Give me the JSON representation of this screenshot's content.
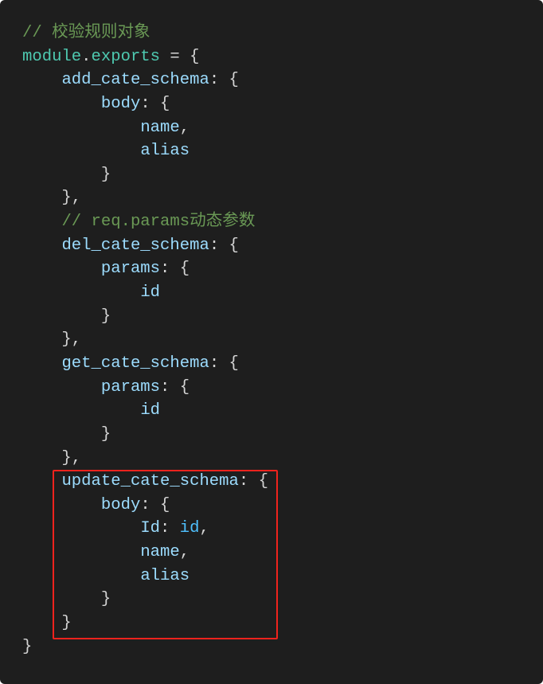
{
  "colors": {
    "background": "#1e1e1e",
    "comment": "#6a9955",
    "module": "#4ec9b0",
    "prop": "#9cdcfe",
    "punct": "#d4d4d4",
    "value": "#4fc1ff",
    "highlight": "#f0231d"
  },
  "lines": [
    [
      [
        "comment",
        "// 校验规则对象"
      ]
    ],
    [
      [
        "module",
        "module"
      ],
      [
        "punct",
        "."
      ],
      [
        "module",
        "exports"
      ],
      [
        "punct",
        " = {"
      ]
    ],
    [
      [
        "punct",
        "    "
      ],
      [
        "prop",
        "add_cate_schema"
      ],
      [
        "punct",
        ": {"
      ]
    ],
    [
      [
        "punct",
        "        "
      ],
      [
        "prop",
        "body"
      ],
      [
        "punct",
        ": {"
      ]
    ],
    [
      [
        "punct",
        "            "
      ],
      [
        "prop",
        "name"
      ],
      [
        "punct",
        ","
      ]
    ],
    [
      [
        "punct",
        "            "
      ],
      [
        "prop",
        "alias"
      ]
    ],
    [
      [
        "punct",
        "        }"
      ]
    ],
    [
      [
        "punct",
        "    },"
      ]
    ],
    [
      [
        "punct",
        "    "
      ],
      [
        "comment",
        "// req.params动态参数"
      ]
    ],
    [
      [
        "punct",
        "    "
      ],
      [
        "prop",
        "del_cate_schema"
      ],
      [
        "punct",
        ": {"
      ]
    ],
    [
      [
        "punct",
        "        "
      ],
      [
        "prop",
        "params"
      ],
      [
        "punct",
        ": {"
      ]
    ],
    [
      [
        "punct",
        "            "
      ],
      [
        "prop",
        "id"
      ]
    ],
    [
      [
        "punct",
        "        }"
      ]
    ],
    [
      [
        "punct",
        "    },"
      ]
    ],
    [
      [
        "punct",
        "    "
      ],
      [
        "prop",
        "get_cate_schema"
      ],
      [
        "punct",
        ": {"
      ]
    ],
    [
      [
        "punct",
        "        "
      ],
      [
        "prop",
        "params"
      ],
      [
        "punct",
        ": {"
      ]
    ],
    [
      [
        "punct",
        "            "
      ],
      [
        "prop",
        "id"
      ]
    ],
    [
      [
        "punct",
        "        }"
      ]
    ],
    [
      [
        "punct",
        "    },"
      ]
    ],
    [
      [
        "punct",
        "    "
      ],
      [
        "prop",
        "update_cate_schema"
      ],
      [
        "punct",
        ": {"
      ]
    ],
    [
      [
        "punct",
        "        "
      ],
      [
        "prop",
        "body"
      ],
      [
        "punct",
        ": {"
      ]
    ],
    [
      [
        "punct",
        "            "
      ],
      [
        "prop",
        "Id"
      ],
      [
        "punct",
        ": "
      ],
      [
        "value",
        "id"
      ],
      [
        "punct",
        ","
      ]
    ],
    [
      [
        "punct",
        "            "
      ],
      [
        "prop",
        "name"
      ],
      [
        "punct",
        ","
      ]
    ],
    [
      [
        "punct",
        "            "
      ],
      [
        "prop",
        "alias"
      ]
    ],
    [
      [
        "punct",
        "        }"
      ]
    ],
    [
      [
        "punct",
        "    }"
      ]
    ],
    [
      [
        "punct",
        "}"
      ]
    ]
  ]
}
